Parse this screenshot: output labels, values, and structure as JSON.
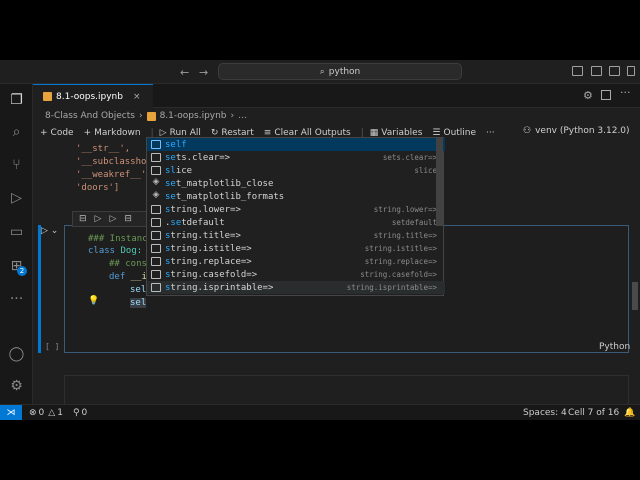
{
  "titlebar": {
    "search_text": "python"
  },
  "tab": {
    "label": "8.1-oops.ipynb",
    "close": "×"
  },
  "breadcrumb": {
    "folder": "8-Class And Objects",
    "sep": "›",
    "file": "8.1-oops.ipynb",
    "more": "…"
  },
  "toolbar": {
    "code": "Code",
    "markdown": "Markdown",
    "run_all": "Run All",
    "restart": "Restart",
    "clear_all": "Clear All Outputs",
    "variables": "Variables",
    "outline": "Outline",
    "more": "···",
    "kernel": "venv (Python 3.12.0)"
  },
  "prev_output": [
    "'__str__',",
    "'__subclasshoo",
    "'__weakref__',",
    "'doors']"
  ],
  "cell": {
    "line1": "### Instanc",
    "line2_kw": "class",
    "line2_name": "Dog:",
    "line3": "## cons",
    "line4_kw": "def",
    "line4_rest": " __i",
    "line5": "sel",
    "line6": "sel",
    "number": "[ ]",
    "language": "Python"
  },
  "suggestions": [
    {
      "prefix": "",
      "hl": "self",
      "rest": "",
      "detail": "",
      "icon": "[≡]"
    },
    {
      "prefix": "",
      "hl": "se",
      "rest": "ts.clear=>",
      "detail": "sets.clear=>",
      "icon": ""
    },
    {
      "prefix": "",
      "hl": "sl",
      "rest": "ice",
      "detail": "slice",
      "icon": ""
    },
    {
      "prefix": "",
      "hl": "se",
      "rest": "t_matplotlib_close",
      "detail": "",
      "icon": "◈"
    },
    {
      "prefix": "",
      "hl": "se",
      "rest": "t_matplotlib_formats",
      "detail": "",
      "icon": "◈"
    },
    {
      "prefix": "",
      "hl": "s",
      "rest": "tring.lower=>",
      "detail": "string.lower=>",
      "icon": ""
    },
    {
      "prefix": ".",
      "hl": "se",
      "rest": "tdefault",
      "detail": "setdefault",
      "icon": ""
    },
    {
      "prefix": "",
      "hl": "s",
      "rest": "tring.title=>",
      "detail": "string.title=>",
      "icon": ""
    },
    {
      "prefix": "",
      "hl": "s",
      "rest": "tring.istitle=>",
      "detail": "string.istitle=>",
      "icon": ""
    },
    {
      "prefix": "",
      "hl": "s",
      "rest": "tring.replace=>",
      "detail": "string.replace=>",
      "icon": ""
    },
    {
      "prefix": "",
      "hl": "s",
      "rest": "tring.casefold=>",
      "detail": "string.casefold=>",
      "icon": ""
    },
    {
      "prefix": "",
      "hl": "s",
      "rest": "tring.isprintable=>",
      "detail": "string.isprintable=>",
      "icon": ""
    }
  ],
  "statusbar": {
    "errors": "0",
    "warnings": "1",
    "ports": "0",
    "spaces": "Spaces: 4",
    "cell": "Cell 7 of 16"
  },
  "colors": {
    "accent": "#0078d4",
    "selection": "#04395e"
  }
}
